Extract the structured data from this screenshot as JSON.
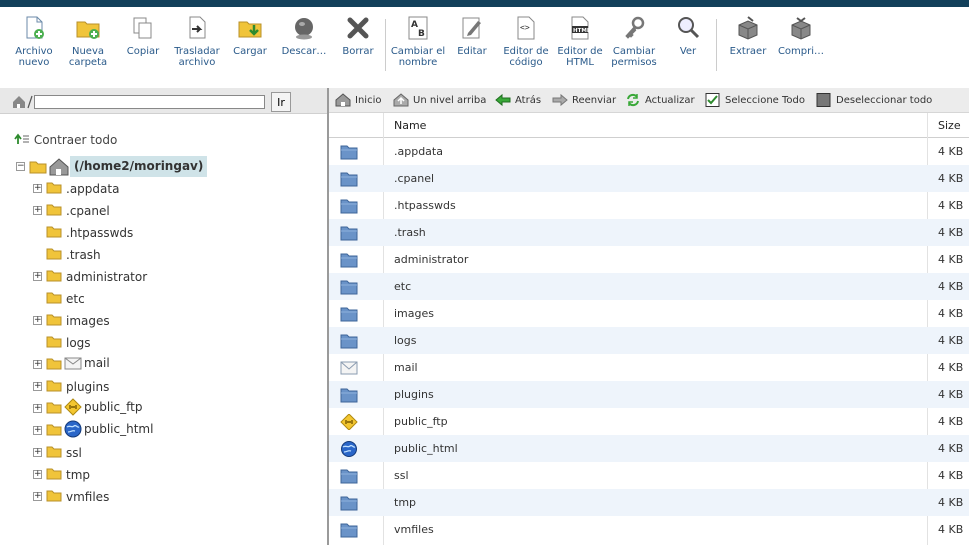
{
  "toolbar": {
    "buttons": [
      {
        "label": "Archivo nuevo",
        "icon": "new-file-icon"
      },
      {
        "label": "Nueva carpeta",
        "icon": "new-folder-icon"
      },
      {
        "label": "Copiar",
        "icon": "copy-icon"
      },
      {
        "label": "Trasladar archivo",
        "icon": "move-icon"
      },
      {
        "label": "Cargar",
        "icon": "upload-icon"
      },
      {
        "label": "Descar…",
        "icon": "download-icon"
      },
      {
        "label": "Borrar",
        "icon": "delete-icon"
      },
      {
        "label": "Cambiar el nombre",
        "icon": "rename-icon"
      },
      {
        "label": "Editar",
        "icon": "edit-icon"
      },
      {
        "label": "Editor de código",
        "icon": "code-editor-icon"
      },
      {
        "label": "Editor de HTML",
        "icon": "html-editor-icon"
      },
      {
        "label": "Cambiar permisos",
        "icon": "permissions-icon"
      },
      {
        "label": "Ver",
        "icon": "view-icon"
      },
      {
        "label": "Extraer",
        "icon": "extract-icon"
      },
      {
        "label": "Compri…",
        "icon": "compress-icon"
      }
    ]
  },
  "sidebar": {
    "path_value": "",
    "go_label": "Ir",
    "collapse_label": "Contraer todo",
    "root_label": "(/home2/moringav)",
    "tree": [
      {
        "label": ".appdata",
        "expandable": true
      },
      {
        "label": ".cpanel",
        "expandable": true
      },
      {
        "label": ".htpasswds",
        "expandable": false
      },
      {
        "label": ".trash",
        "expandable": false
      },
      {
        "label": "administrator",
        "expandable": true
      },
      {
        "label": "etc",
        "expandable": false
      },
      {
        "label": "images",
        "expandable": true
      },
      {
        "label": "logs",
        "expandable": false
      },
      {
        "label": "mail",
        "expandable": true,
        "special": "mail"
      },
      {
        "label": "plugins",
        "expandable": true
      },
      {
        "label": "public_ftp",
        "expandable": true,
        "special": "ftp"
      },
      {
        "label": "public_html",
        "expandable": true,
        "special": "html"
      },
      {
        "label": "ssl",
        "expandable": true
      },
      {
        "label": "tmp",
        "expandable": true
      },
      {
        "label": "vmfiles",
        "expandable": true
      }
    ]
  },
  "nav": {
    "home": "Inicio",
    "up": "Un nivel arriba",
    "back": "Atrás",
    "forward": "Reenviar",
    "refresh": "Actualizar",
    "select_all": "Seleccione Todo",
    "deselect_all": "Deseleccionar todo"
  },
  "grid": {
    "headers": {
      "name": "Name",
      "size": "Size"
    },
    "rows": [
      {
        "name": ".appdata",
        "size": "4 KB",
        "type": "folder"
      },
      {
        "name": ".cpanel",
        "size": "4 KB",
        "type": "folder"
      },
      {
        "name": ".htpasswds",
        "size": "4 KB",
        "type": "folder"
      },
      {
        "name": ".trash",
        "size": "4 KB",
        "type": "folder"
      },
      {
        "name": "administrator",
        "size": "4 KB",
        "type": "folder"
      },
      {
        "name": "etc",
        "size": "4 KB",
        "type": "folder"
      },
      {
        "name": "images",
        "size": "4 KB",
        "type": "folder"
      },
      {
        "name": "logs",
        "size": "4 KB",
        "type": "folder"
      },
      {
        "name": "mail",
        "size": "4 KB",
        "type": "mail"
      },
      {
        "name": "plugins",
        "size": "4 KB",
        "type": "folder"
      },
      {
        "name": "public_ftp",
        "size": "4 KB",
        "type": "ftp"
      },
      {
        "name": "public_html",
        "size": "4 KB",
        "type": "html"
      },
      {
        "name": "ssl",
        "size": "4 KB",
        "type": "folder"
      },
      {
        "name": "tmp",
        "size": "4 KB",
        "type": "folder"
      },
      {
        "name": "vmfiles",
        "size": "4 KB",
        "type": "folder"
      }
    ]
  },
  "colors": {
    "topbar": "#12405a",
    "toolbar_text": "#2a5a8a",
    "row_alt": "#eef4fb",
    "root_highlight": "#cfe3e8",
    "folder_blue": "#6a93c8",
    "folder_yellow": "#f0c43a"
  }
}
